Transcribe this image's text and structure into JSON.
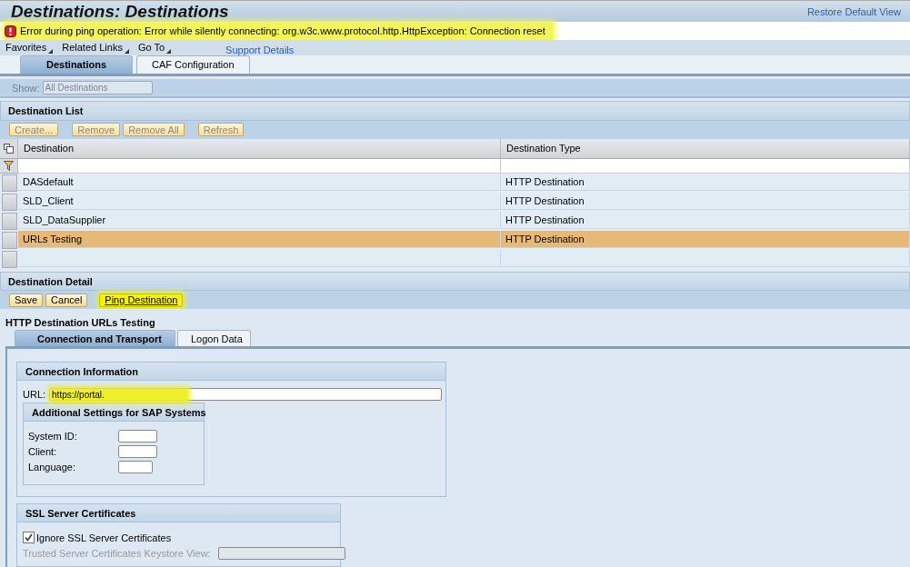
{
  "header": {
    "title": "Destinations: Destinations",
    "link": "Restore Default View"
  },
  "message": {
    "kind": "error",
    "text": "Error during ping operation: Error while silently connecting: org.w3c.www.protocol.http.HttpException: Connection reset",
    "highlighted": true
  },
  "menu": {
    "items": [
      "Favorites",
      "Related Links",
      "Go To"
    ],
    "link": "Support Details"
  },
  "tabs": [
    {
      "label": "Destinations",
      "selected": true
    },
    {
      "label": "CAF Configuration",
      "selected": false
    }
  ],
  "show": {
    "label": "Show:",
    "value": "All Destinations",
    "disabled": true
  },
  "destination_list": {
    "title": "Destination List",
    "buttons": [
      {
        "label": "Create...",
        "disabled": true
      },
      {
        "label": "Remove",
        "disabled": true
      },
      {
        "label": "Remove All",
        "disabled": true
      },
      {
        "label": "Refresh",
        "disabled": true
      }
    ],
    "columns": [
      "Destination",
      "Destination Type"
    ],
    "rows": [
      {
        "cells": [
          "DASdefault",
          "HTTP Destination"
        ],
        "selected": false
      },
      {
        "cells": [
          "SLD_Client",
          "HTTP Destination"
        ],
        "selected": false
      },
      {
        "cells": [
          "SLD_DataSupplier",
          "HTTP Destination"
        ],
        "selected": false
      },
      {
        "cells": [
          "URLs Testing",
          "HTTP Destination"
        ],
        "selected": true
      }
    ]
  },
  "destination_detail": {
    "title": "Destination Detail",
    "buttons": [
      {
        "label": "Save",
        "highlighted": false
      },
      {
        "label": "Cancel",
        "highlighted": false
      },
      {
        "label": "Ping Destination",
        "highlighted": true
      }
    ],
    "heading": "HTTP Destination URLs Testing",
    "tabs": [
      {
        "label": "Connection and Transport",
        "selected": true
      },
      {
        "label": "Logon Data",
        "selected": false
      }
    ],
    "connection": {
      "title": "Connection Information",
      "url_label": "URL:",
      "url_value": "https://portal.",
      "url_highlighted": true,
      "sap": {
        "title": "Additional Settings for SAP Systems",
        "fields": [
          {
            "label": "System ID:"
          },
          {
            "label": "Client:"
          },
          {
            "label": "Language:"
          }
        ]
      }
    },
    "ssl": {
      "title": "SSL Server Certificates",
      "checkbox": {
        "label": "Ignore SSL Server Certificates",
        "checked": true
      },
      "keystore": {
        "label": "Trusted Server Certificates Keystore View:",
        "disabled": true
      }
    }
  }
}
